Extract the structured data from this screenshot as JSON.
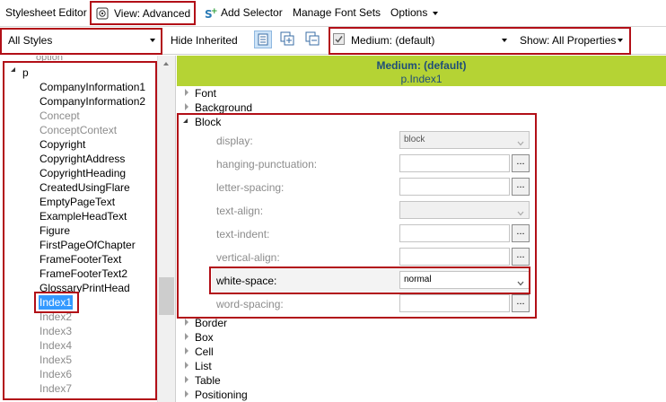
{
  "toolbar": {
    "title": "Stylesheet Editor",
    "view_label": "View: Advanced",
    "add_selector_label": "Add Selector",
    "manage_font_sets_label": "Manage Font Sets",
    "options_label": "Options"
  },
  "filters": {
    "styles_filter_value": "All Styles",
    "hide_inherited_label": "Hide Inherited",
    "medium_value": "Medium: (default)",
    "show_value": "Show: All Properties"
  },
  "tree": {
    "partial_top": "option",
    "root_label": "p",
    "items": [
      {
        "label": "CompanyInformation1",
        "style": "normal"
      },
      {
        "label": "CompanyInformation2",
        "style": "normal"
      },
      {
        "label": "Concept",
        "style": "gray"
      },
      {
        "label": "ConceptContext",
        "style": "gray"
      },
      {
        "label": "Copyright",
        "style": "normal"
      },
      {
        "label": "CopyrightAddress",
        "style": "normal"
      },
      {
        "label": "CopyrightHeading",
        "style": "normal"
      },
      {
        "label": "CreatedUsingFlare",
        "style": "normal"
      },
      {
        "label": "EmptyPageText",
        "style": "normal"
      },
      {
        "label": "ExampleHeadText",
        "style": "normal"
      },
      {
        "label": "Figure",
        "style": "normal"
      },
      {
        "label": "FirstPageOfChapter",
        "style": "normal"
      },
      {
        "label": "FrameFooterText",
        "style": "normal"
      },
      {
        "label": "FrameFooterText2",
        "style": "normal"
      },
      {
        "label": "GlossaryPrintHead",
        "style": "normal"
      },
      {
        "label": "Index1",
        "style": "selected"
      },
      {
        "label": "Index2",
        "style": "gray"
      },
      {
        "label": "Index3",
        "style": "gray"
      },
      {
        "label": "Index4",
        "style": "gray"
      },
      {
        "label": "Index5",
        "style": "gray"
      },
      {
        "label": "Index6",
        "style": "gray"
      },
      {
        "label": "Index7",
        "style": "gray"
      }
    ]
  },
  "panel": {
    "medium_header": "Medium: (default)",
    "selector_header": "p.Index1",
    "sections_before": [
      "Font",
      "Background"
    ],
    "open_section": "Block",
    "properties": [
      {
        "name": "display",
        "label": "display:",
        "value": "block",
        "kind": "dropdown",
        "enabled": false
      },
      {
        "name": "hanging-punctuation",
        "label": "hanging-punctuation:",
        "value": "",
        "kind": "ellipsis"
      },
      {
        "name": "letter-spacing",
        "label": "letter-spacing:",
        "value": "",
        "kind": "ellipsis"
      },
      {
        "name": "text-align",
        "label": "text-align:",
        "value": "",
        "kind": "dropdown",
        "enabled": false
      },
      {
        "name": "text-indent",
        "label": "text-indent:",
        "value": "",
        "kind": "ellipsis"
      },
      {
        "name": "vertical-align",
        "label": "vertical-align:",
        "value": "",
        "kind": "ellipsis"
      },
      {
        "name": "white-space",
        "label": "white-space:",
        "value": "normal",
        "kind": "dropdown",
        "enabled": true
      },
      {
        "name": "word-spacing",
        "label": "word-spacing:",
        "value": "",
        "kind": "ellipsis"
      }
    ],
    "ellipsis_label": "...",
    "sections_after": [
      "Border",
      "Box",
      "Cell",
      "List",
      "Table",
      "Positioning"
    ]
  },
  "colors": {
    "accent_red": "#b20f17",
    "header_green": "#b5d334",
    "selection_blue": "#3399ff",
    "header_text_blue": "#1f4e79"
  }
}
